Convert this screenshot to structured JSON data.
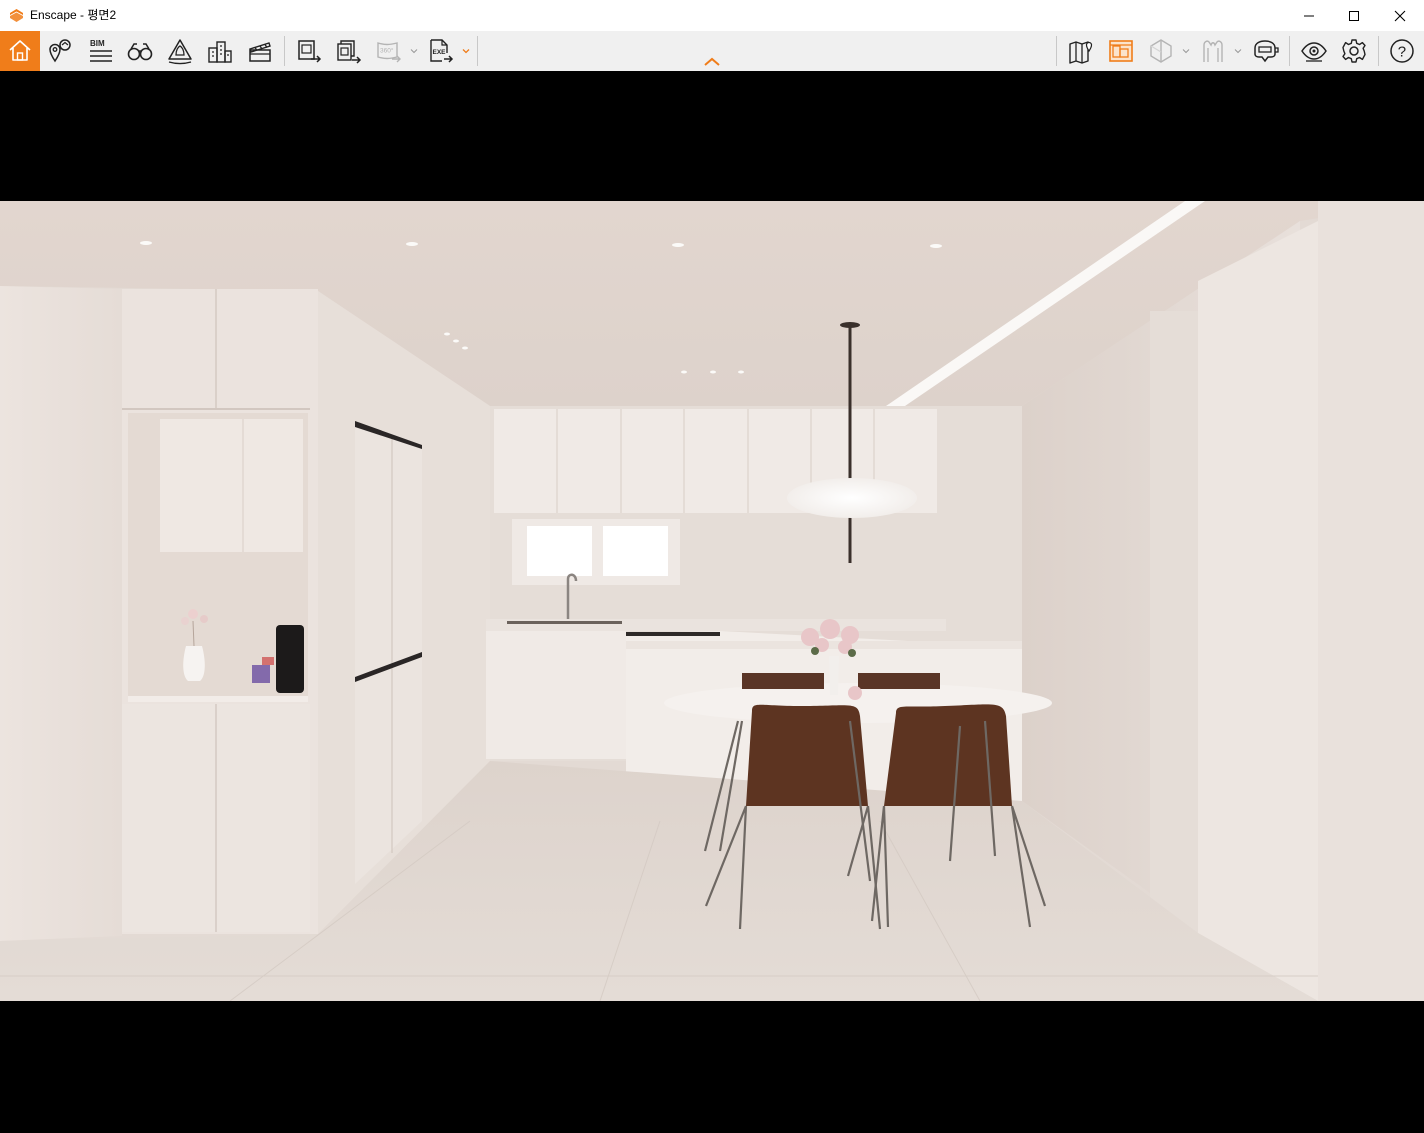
{
  "window": {
    "title": "Enscape - 평면2",
    "accent_color": "#f07d1a"
  },
  "title_buttons": [
    {
      "name": "minimize-button",
      "icon": "minimize-icon"
    },
    {
      "name": "maximize-button",
      "icon": "maximize-icon"
    },
    {
      "name": "close-button",
      "icon": "close-icon"
    }
  ],
  "toolbar": {
    "left_tools": [
      {
        "icon": "home-icon",
        "active": true
      },
      {
        "icon": "view-management-icon"
      },
      {
        "icon": "bim-icon",
        "label": "BIM"
      },
      {
        "icon": "binoculars-icon"
      },
      {
        "icon": "atmosphere-icon"
      },
      {
        "icon": "asset-library-icon"
      },
      {
        "icon": "video-editor-icon"
      }
    ],
    "export_tools": [
      {
        "icon": "screenshot-export-icon"
      },
      {
        "icon": "batch-render-icon"
      },
      {
        "icon": "panorama-360-icon",
        "label": "360°",
        "disabled": true
      },
      {
        "icon": "standalone-exe-icon",
        "label": "EXE"
      }
    ],
    "right_tools": [
      {
        "icon": "map-icon"
      },
      {
        "icon": "orthographic-view-icon",
        "active_color": true
      },
      {
        "icon": "section-icon",
        "disabled": true
      },
      {
        "icon": "vr-headset-icon",
        "disabled": true
      },
      {
        "icon": "collaborative-annotation-icon"
      },
      {
        "icon": "visual-settings-icon"
      },
      {
        "icon": "general-settings-icon"
      },
      {
        "icon": "help-icon",
        "label": "?"
      }
    ]
  },
  "viewport": {
    "scene": "kitchen-dining-render"
  }
}
